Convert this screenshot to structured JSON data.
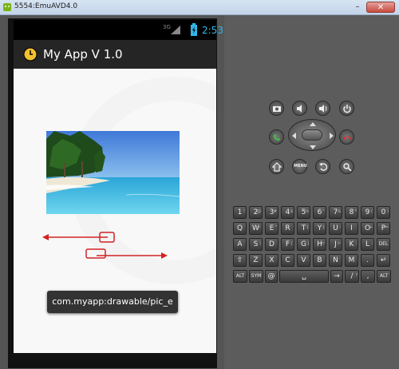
{
  "window": {
    "title": "5554:EmuAVD4.0",
    "min_glyph": "–",
    "close_glyph": "✕"
  },
  "statusbar": {
    "network": "3G",
    "time": "2:53"
  },
  "app": {
    "title": "My App V 1.0"
  },
  "toast": {
    "text": "com.myapp:drawable/pic_e"
  },
  "controls": {
    "row1": [
      "camera-icon",
      "volume-down-icon",
      "volume-up-icon",
      "power-icon"
    ],
    "row2": [
      "call-icon",
      "dpad",
      "end-call-icon"
    ],
    "row3": [
      "home-icon",
      "menu-button",
      "back-icon",
      "search-icon"
    ],
    "menu_label": "MENU"
  },
  "keyboard": {
    "row1": [
      {
        "k": "1",
        "s": "!"
      },
      {
        "k": "2",
        "s": "@"
      },
      {
        "k": "3",
        "s": "#"
      },
      {
        "k": "4",
        "s": "$"
      },
      {
        "k": "5",
        "s": "%"
      },
      {
        "k": "6",
        "s": "^"
      },
      {
        "k": "7",
        "s": "&"
      },
      {
        "k": "8",
        "s": "*"
      },
      {
        "k": "9",
        "s": "("
      },
      {
        "k": "0",
        "s": ")"
      }
    ],
    "row2": [
      {
        "k": "Q",
        "s": ""
      },
      {
        "k": "W",
        "s": "~"
      },
      {
        "k": "E",
        "s": "\""
      },
      {
        "k": "R",
        "s": ""
      },
      {
        "k": "T",
        "s": "{"
      },
      {
        "k": "Y",
        "s": "}"
      },
      {
        "k": "U",
        "s": "-"
      },
      {
        "k": "I",
        "s": ""
      },
      {
        "k": "O",
        "s": "+"
      },
      {
        "k": "P",
        "s": "="
      }
    ],
    "row3": [
      {
        "k": "A",
        "s": ""
      },
      {
        "k": "S",
        "s": "\\"
      },
      {
        "k": "D",
        "s": ""
      },
      {
        "k": "F",
        "s": "["
      },
      {
        "k": "G",
        "s": "]"
      },
      {
        "k": "H",
        "s": "<"
      },
      {
        "k": "J",
        "s": ">"
      },
      {
        "k": "K",
        "s": ";"
      },
      {
        "k": "L",
        "s": ":"
      },
      {
        "k": "DEL",
        "s": ""
      }
    ],
    "row4": [
      {
        "k": "⇧",
        "s": ""
      },
      {
        "k": "Z",
        "s": ""
      },
      {
        "k": "X",
        "s": ""
      },
      {
        "k": "C",
        "s": ""
      },
      {
        "k": "V",
        "s": ""
      },
      {
        "k": "B",
        "s": ""
      },
      {
        "k": "N",
        "s": ""
      },
      {
        "k": "M",
        "s": ""
      },
      {
        "k": ".",
        "s": ""
      },
      {
        "k": "↵",
        "s": ""
      }
    ],
    "row5": [
      {
        "k": "ALT",
        "s": ""
      },
      {
        "k": "SYM",
        "s": ""
      },
      {
        "k": "@",
        "s": ""
      },
      {
        "k": "␣",
        "s": ""
      },
      {
        "k": "→",
        "s": ""
      },
      {
        "k": "/",
        "s": "?"
      },
      {
        "k": ",",
        "s": ""
      },
      {
        "k": "ALT",
        "s": ""
      }
    ]
  },
  "colors": {
    "accent_clock": "#33b5e5",
    "arrow_red": "#d32222"
  }
}
